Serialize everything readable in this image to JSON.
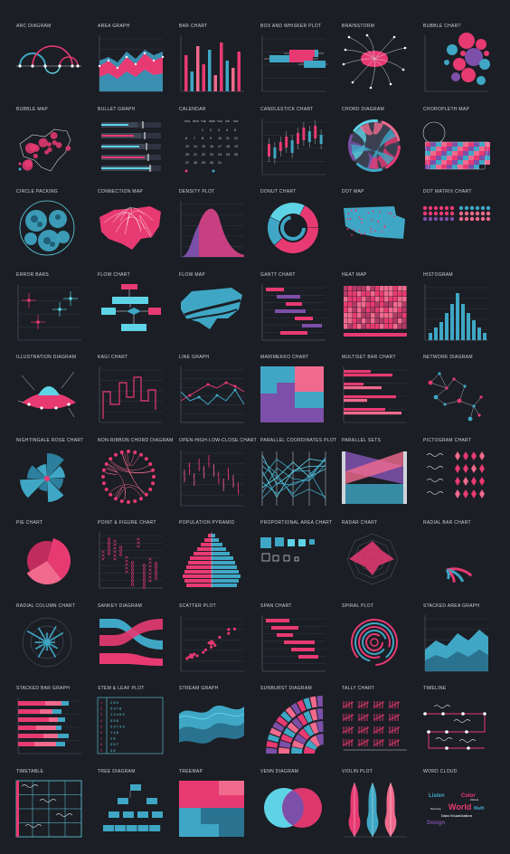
{
  "colors": {
    "pink": "#e83a72",
    "blue": "#3fa7c5",
    "cyan": "#5fd3e6",
    "purple": "#7c4fa8",
    "lightpink": "#f06a8e",
    "grid": "#5a6070",
    "text": "#cfd3da",
    "bg": "#1b1e24"
  },
  "charts": [
    {
      "label": "ARC DIAGRAM",
      "kind": "arc"
    },
    {
      "label": "AREA GRAPH",
      "kind": "area"
    },
    {
      "label": "BAR CHART",
      "kind": "bar"
    },
    {
      "label": "BOX AND WHISKER PLOT",
      "kind": "box"
    },
    {
      "label": "BRAINSTORM",
      "kind": "brainstorm"
    },
    {
      "label": "BUBBLE CHART",
      "kind": "bubble"
    },
    {
      "label": "BUBBLE MAP",
      "kind": "bubblemap"
    },
    {
      "label": "BULLET GRAPH",
      "kind": "bullet"
    },
    {
      "label": "CALENDAR",
      "kind": "calendar"
    },
    {
      "label": "CANDLESTICK CHART",
      "kind": "candle"
    },
    {
      "label": "CHORD DIAGRAM",
      "kind": "chord"
    },
    {
      "label": "CHOROPLETH MAP",
      "kind": "choropleth"
    },
    {
      "label": "CIRCLE PACKING",
      "kind": "circlepack"
    },
    {
      "label": "CONNECTION MAP",
      "kind": "connmap"
    },
    {
      "label": "DENSITY PLOT",
      "kind": "density"
    },
    {
      "label": "DONUT CHART",
      "kind": "donut"
    },
    {
      "label": "DOT MAP",
      "kind": "dotmap"
    },
    {
      "label": "DOT MATRIX CHART",
      "kind": "dotmatrix"
    },
    {
      "label": "ERROR BARS",
      "kind": "errorbars"
    },
    {
      "label": "FLOW CHART",
      "kind": "flowchart"
    },
    {
      "label": "FLOW MAP",
      "kind": "flowmap"
    },
    {
      "label": "GANTT CHART",
      "kind": "gantt"
    },
    {
      "label": "HEAT MAP",
      "kind": "heatmap"
    },
    {
      "label": "HISTOGRAM",
      "kind": "histogram"
    },
    {
      "label": "ILLUSTRATION DIAGRAM",
      "kind": "illustration"
    },
    {
      "label": "KAGI CHART",
      "kind": "kagi"
    },
    {
      "label": "LINE GRAPH",
      "kind": "line"
    },
    {
      "label": "MARIMEKKO CHART",
      "kind": "marimekko"
    },
    {
      "label": "MULTISET BAR CHART",
      "kind": "multiset"
    },
    {
      "label": "NETWORK DIAGRAM",
      "kind": "network"
    },
    {
      "label": "NIGHTINGALE ROSE CHART",
      "kind": "nightingale"
    },
    {
      "label": "NON-RIBBON CHORD DIAGRAM",
      "kind": "nonribbon"
    },
    {
      "label": "OPEN-HIGH-LOW-CLOSE CHART",
      "kind": "ohlc"
    },
    {
      "label": "PARALLEL COORDINATES PLOT",
      "kind": "parallelcoords"
    },
    {
      "label": "PARALLEL SETS",
      "kind": "parallelsets"
    },
    {
      "label": "PICTOGRAM CHART",
      "kind": "pictogram"
    },
    {
      "label": "PIE CHART",
      "kind": "pie"
    },
    {
      "label": "POINT & FIGURE CHART",
      "kind": "pointfigure"
    },
    {
      "label": "POPULATION PYRAMID",
      "kind": "pyramid"
    },
    {
      "label": "PROPORTIONAL AREA CHART",
      "kind": "proparea"
    },
    {
      "label": "RADAR CHART",
      "kind": "radar"
    },
    {
      "label": "RADIAL BAR CHART",
      "kind": "radialbar"
    },
    {
      "label": "RADIAL COLUMN CHART",
      "kind": "radialcolumn"
    },
    {
      "label": "SANKEY DIAGRAM",
      "kind": "sankey"
    },
    {
      "label": "SCATTER PLOT",
      "kind": "scatter"
    },
    {
      "label": "SPAN CHART",
      "kind": "span"
    },
    {
      "label": "SPIRAL PLOT",
      "kind": "spiral"
    },
    {
      "label": "STACKED AREA GRAPH",
      "kind": "stackedarea"
    },
    {
      "label": "STACKED BAR GRAPH",
      "kind": "stackedbar"
    },
    {
      "label": "STEM & LEAF PLOT",
      "kind": "stemleaf"
    },
    {
      "label": "STREAM GRAPH",
      "kind": "stream"
    },
    {
      "label": "SUNBURST DIAGRAM",
      "kind": "sunburst"
    },
    {
      "label": "TALLY CHART",
      "kind": "tally"
    },
    {
      "label": "TIMELINE",
      "kind": "timeline"
    },
    {
      "label": "TIMETABLE",
      "kind": "timetable"
    },
    {
      "label": "TREE DIAGRAM",
      "kind": "tree"
    },
    {
      "label": "TREEMAP",
      "kind": "treemap"
    },
    {
      "label": "VENN DIAGRAM",
      "kind": "venn"
    },
    {
      "label": "VIOLIN PLOT",
      "kind": "violin"
    },
    {
      "label": "WORD CLOUD",
      "kind": "wordcloud"
    }
  ],
  "calendar": {
    "days": [
      "SUN",
      "MON",
      "TUE",
      "WED",
      "THU",
      "FRI",
      "SAT"
    ],
    "numbers": [
      [
        "",
        "",
        "1",
        "2",
        "3",
        "4",
        "5"
      ],
      [
        "6",
        "7",
        "8",
        "9",
        "10",
        "11",
        "12"
      ],
      [
        "13",
        "14",
        "15",
        "16",
        "17",
        "18",
        "19"
      ],
      [
        "20",
        "21",
        "22",
        "23",
        "24",
        "25",
        "26"
      ],
      [
        "27",
        "28",
        "29",
        "30",
        "31",
        "",
        ""
      ]
    ]
  },
  "stemleaf": {
    "stems": [
      "1",
      "2",
      "3",
      "4",
      "5",
      "6",
      "7",
      "8",
      "9"
    ],
    "leaves": [
      "2 5 9",
      "0 3 7 8",
      "1 2 4 6 9",
      "0 5 8",
      "3 3 7 9 9",
      "1 4 6",
      "2 8",
      "0 5 7",
      "3 6"
    ]
  },
  "wordcloud": {
    "words": [
      "Listen",
      "Color",
      "World",
      "Math",
      "Data Visualization",
      "Design",
      "Security",
      "Inform"
    ]
  }
}
